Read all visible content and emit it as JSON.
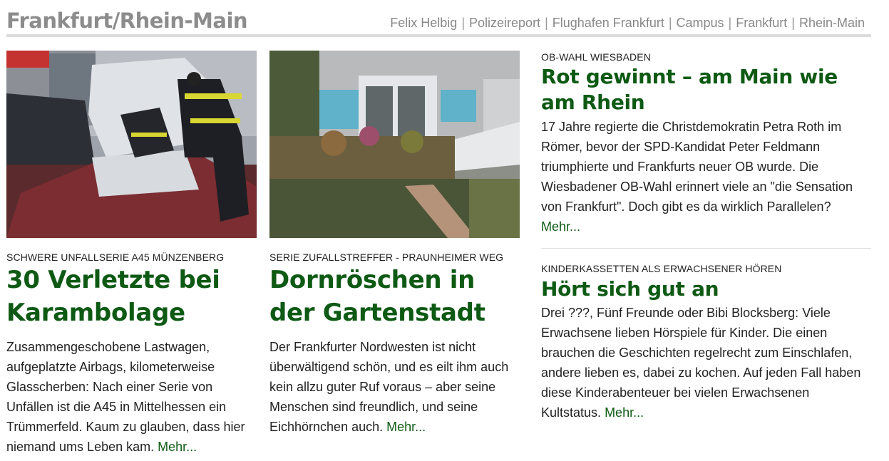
{
  "header": {
    "title": "Frankfurt/Rhein-Main",
    "nav": [
      "Felix Helbig",
      "Polizeireport",
      "Flughafen Frankfurt",
      "Campus",
      "Frankfurt",
      "Rhein-Main"
    ],
    "separator": "|"
  },
  "articles": [
    {
      "kicker": "Schwere Unfallserie A45 Münzenberg",
      "headline": "30 Verletzte bei Karambolage",
      "teaser": "Zusammengeschobene Lastwagen, aufgeplatzte Airbags, kilometerweise Glasscherben: Nach einer Serie von Unfällen ist die A45 in Mittelhessen ein Trümmerfeld. Kaum zu glauben, dass hier niemand ums Leben kam.",
      "more": "Mehr..."
    },
    {
      "kicker": "Serie Zufallstreffer - Praunheimer Weg",
      "headline": "Dornröschen in der Gartenstadt",
      "teaser": "Der Frankfurter Nordwesten ist nicht überwältigend schön, und es eilt ihm auch kein allzu guter Ruf voraus – aber seine Menschen sind freundlich, und seine Eichhörnchen auch.",
      "more": "Mehr..."
    },
    {
      "kicker": "OB-Wahl Wiesbaden",
      "headline": "Rot gewinnt – am Main wie am Rhein",
      "teaser": "17 Jahre regierte die Christdemokratin Petra Roth im Römer, bevor der SPD-Kandidat Peter Feldmann triumphierte und Frankfurts neuer OB wurde. Die Wiesbadener OB-Wahl erinnert viele an \"die Sensation von Frankfurt\". Doch gibt es da wirklich Parallelen?",
      "more": "Mehr..."
    },
    {
      "kicker": "Kinderkassetten als Erwachsener hören",
      "headline": "Hört sich gut an",
      "teaser": "Drei ???, Fünf Freunde oder Bibi Blocksberg: Viele Erwachsene lieben Hörspiele für Kinder. Die einen brauchen die Geschichten regelrecht zum Einschlafen, andere lieben es, dabei zu kochen. Auf jeden Fall haben diese Kinderabenteuer bei vielen Erwachsenen Kultstatus.",
      "more": "Mehr..."
    }
  ],
  "colors": {
    "headline": "#0e5a14",
    "section_title": "#8c8c8c",
    "nav": "#888888"
  }
}
